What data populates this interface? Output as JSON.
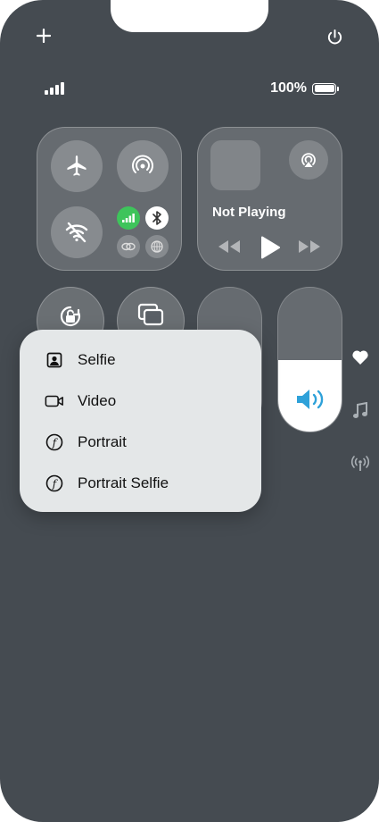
{
  "top_bar": {
    "add_icon": "plus-icon",
    "power_icon": "power-icon"
  },
  "status": {
    "battery_percent": "100%"
  },
  "connectivity": {
    "airplane": "airplane-icon",
    "airdrop": "airdrop-icon",
    "wifi": "wifi-off-icon",
    "cellular": "cellular-icon",
    "bluetooth": "bluetooth-icon",
    "focus": "link-icon",
    "hotspot": "globe-icon"
  },
  "now_playing": {
    "status": "Not Playing"
  },
  "volume": {
    "level": 0.5,
    "accent": "#2ea1d9"
  },
  "camera_menu": {
    "items": [
      {
        "label": "Selfie",
        "icon": "selfie-icon"
      },
      {
        "label": "Video",
        "icon": "video-icon"
      },
      {
        "label": "Portrait",
        "icon": "portrait-icon"
      },
      {
        "label": "Portrait Selfie",
        "icon": "portrait-selfie-icon"
      }
    ]
  },
  "side_icons": [
    "heart-icon",
    "music-note-icon",
    "antenna-icon"
  ],
  "colors": {
    "background": "#454b51",
    "green": "#3ec45b",
    "menu_bg": "#e4e7e8"
  }
}
